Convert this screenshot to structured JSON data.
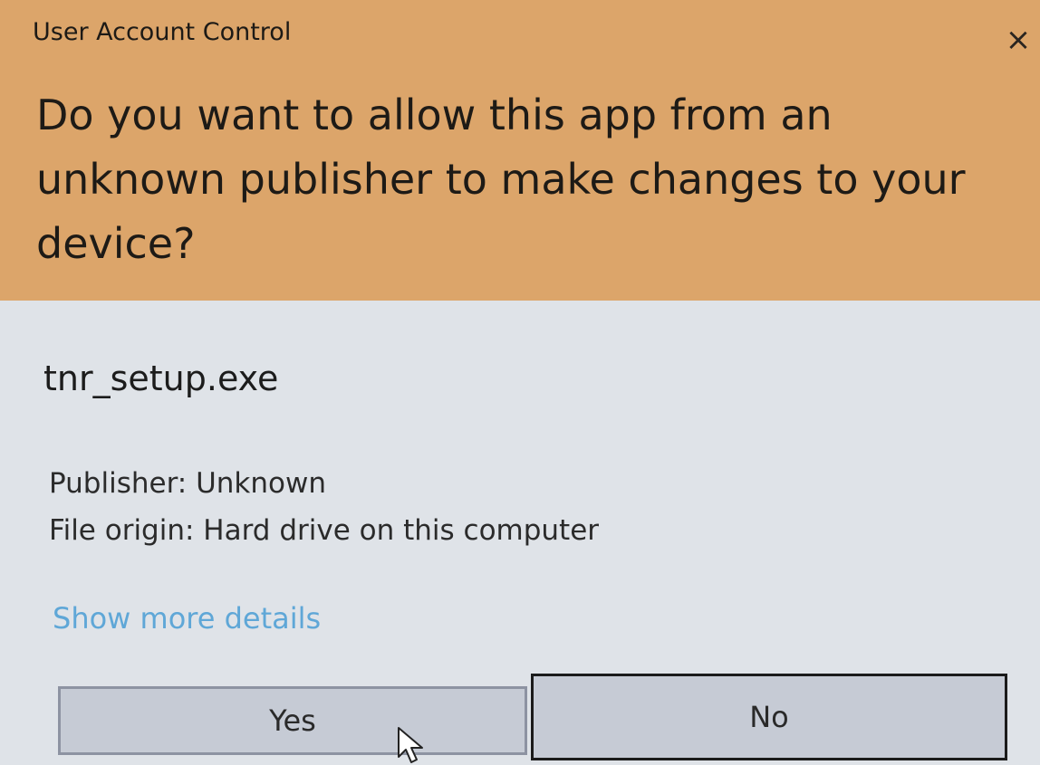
{
  "window": {
    "title": "User Account Control",
    "close_label": "×"
  },
  "prompt": {
    "question": "Do you want to allow this app from an unknown publisher to make changes to your device?"
  },
  "app": {
    "name": "tnr_setup.exe",
    "publisher": "Publisher: Unknown",
    "file_origin": "File origin: Hard drive on this computer",
    "details_link": "Show more details"
  },
  "buttons": {
    "yes": "Yes",
    "no": "No"
  },
  "colors": {
    "header": "#dca56a",
    "body": "#dfe3e8",
    "link": "#5fa7d7",
    "button": "#c6cbd5"
  }
}
